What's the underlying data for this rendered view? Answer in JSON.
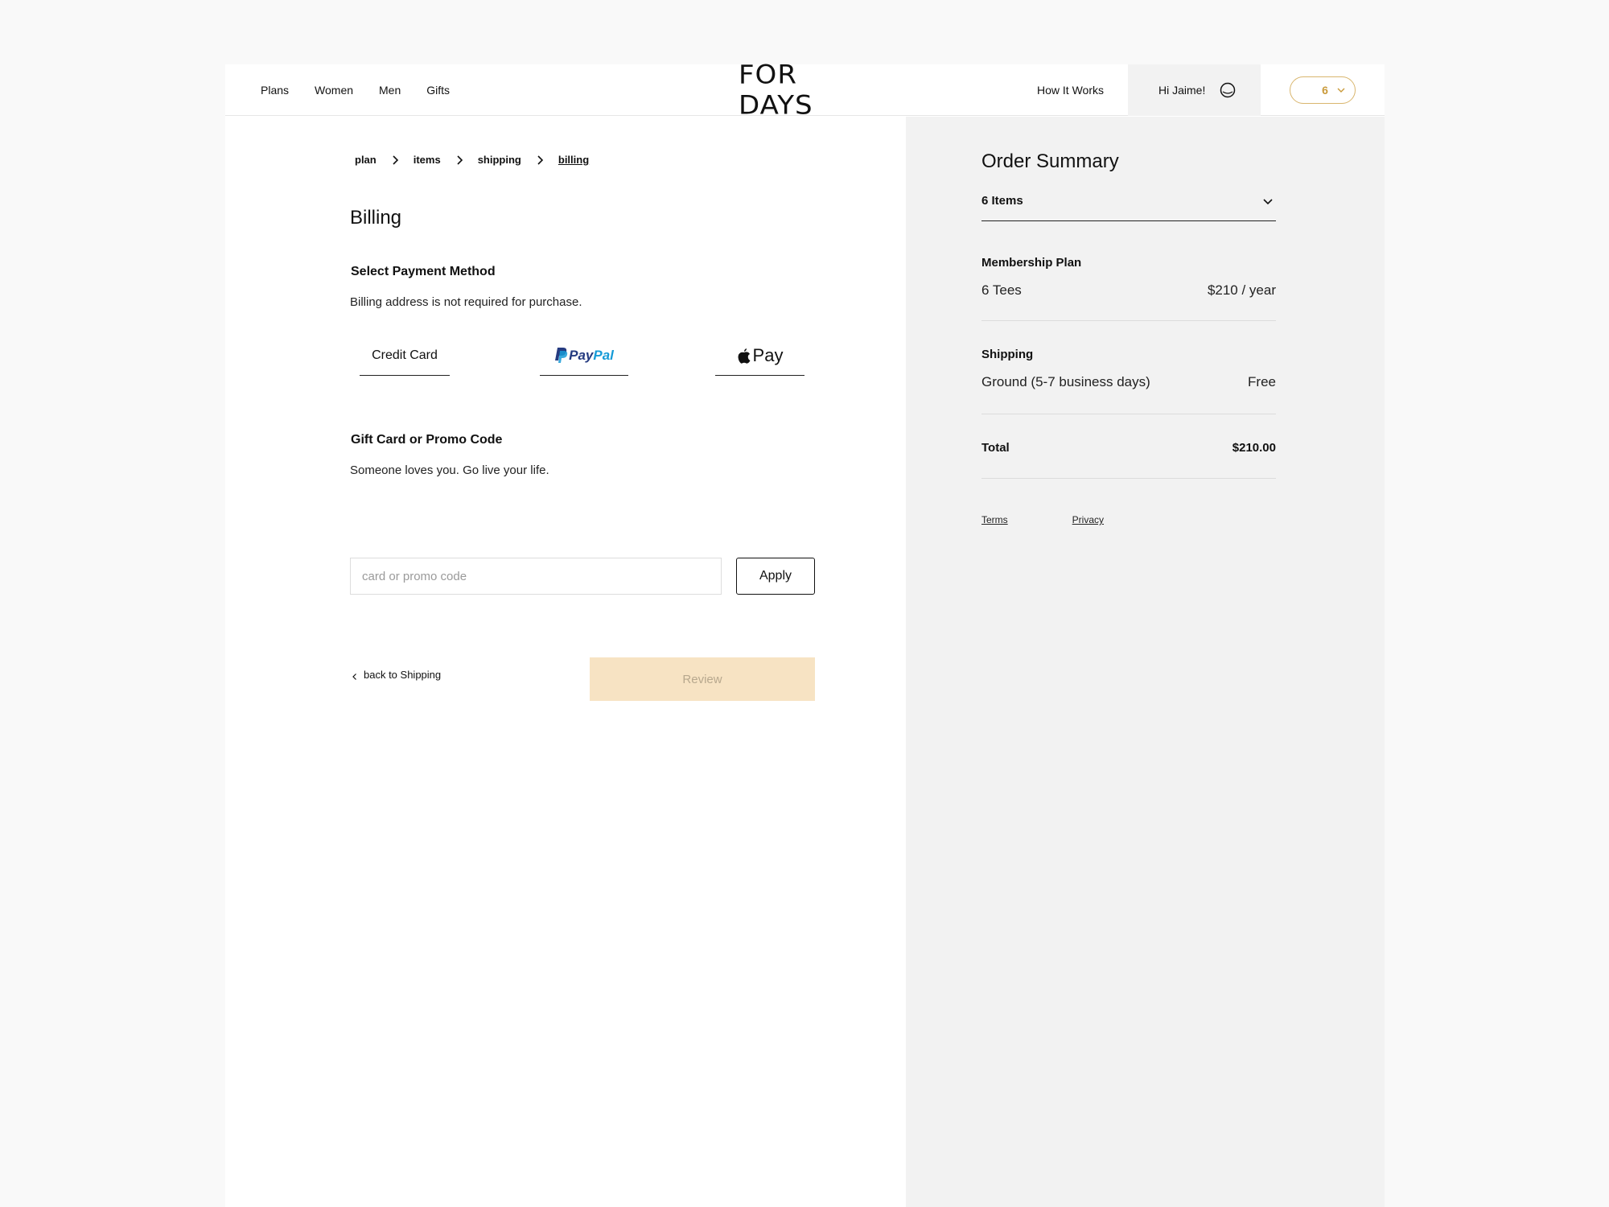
{
  "header": {
    "nav": [
      "Plans",
      "Women",
      "Men",
      "Gifts"
    ],
    "logo": "FOR DAYS",
    "how_it_works": "How It Works",
    "greeting": "Hi Jaime!",
    "cart_count": "6"
  },
  "breadcrumb": [
    "plan",
    "items",
    "shipping",
    "billing"
  ],
  "billing": {
    "title": "Billing",
    "payment_title": "Select Payment Method",
    "payment_sub": "Billing address is not required for purchase.",
    "methods": {
      "credit": "Credit Card",
      "paypal_a": "Pay",
      "paypal_b": "Pal",
      "applepay": "Pay"
    },
    "promo_title": "Gift Card or Promo Code",
    "promo_sub": "Someone loves you. Go live your life.",
    "promo_placeholder": "card or promo code",
    "apply": "Apply",
    "back": "back to Shipping",
    "review": "Review"
  },
  "summary": {
    "title": "Order Summary",
    "items": "6 Items",
    "plan_label": "Membership Plan",
    "plan_name": "6 Tees",
    "plan_price": "$210 / year",
    "shipping_label": "Shipping",
    "shipping_name": "Ground (5-7 business days)",
    "shipping_price": "Free",
    "total_label": "Total",
    "total_value": "$210.00",
    "terms": "Terms",
    "privacy": "Privacy"
  },
  "colors": {
    "accent": "#d9b66e",
    "review_bg": "#f7e3c3",
    "summary_bg": "#f2f2f2"
  }
}
